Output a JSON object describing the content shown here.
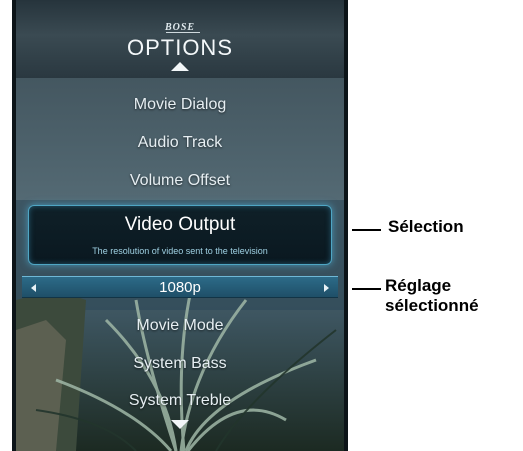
{
  "menu": {
    "brand": "BOSE",
    "title": "OPTIONS",
    "items_above": [
      "Movie Dialog",
      "Audio Track",
      "Volume Offset"
    ],
    "selected": {
      "label": "Video Output",
      "description": "The resolution of video sent to the television",
      "value": "1080p"
    },
    "items_below": [
      "Movie Mode",
      "System Bass",
      "System Treble"
    ]
  },
  "callouts": {
    "selection": "Sélection",
    "setting_line1": "Réglage",
    "setting_line2": "sélectionné"
  },
  "icons": [
    "scroll-up-icon",
    "scroll-down-icon",
    "previous-value-icon",
    "next-value-icon"
  ],
  "colors": {
    "highlight_border": "#4fa6c4",
    "value_bar": "#2c6b88",
    "menu_text": "#e6eef2"
  }
}
